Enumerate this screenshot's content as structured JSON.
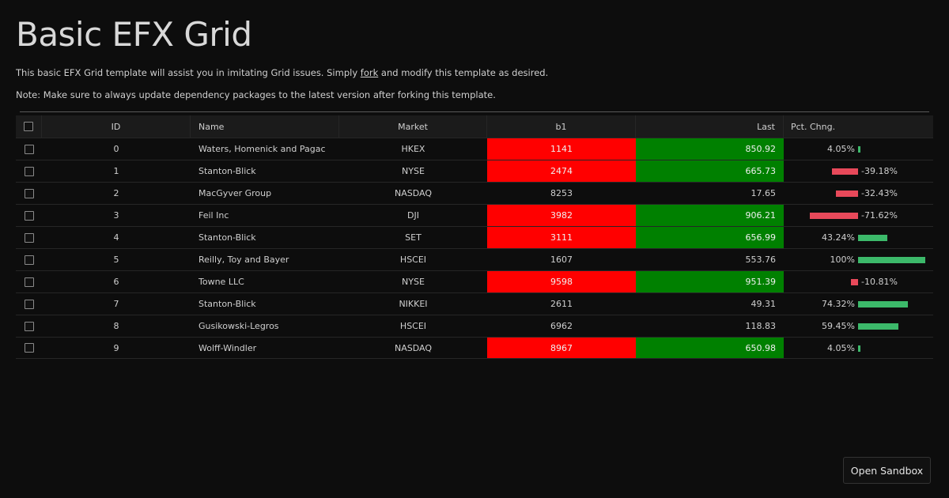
{
  "page": {
    "title": "Basic EFX Grid",
    "desc1_before": "This basic EFX Grid template will assist you in imitating Grid issues. Simply ",
    "desc1_link": "fork",
    "desc1_after": " and modify this template as desired.",
    "desc2": "Note: Make sure to always update dependency packages to the latest version after forking this template."
  },
  "grid": {
    "headers": {
      "id": "ID",
      "name": "Name",
      "market": "Market",
      "b1": "b1",
      "last": "Last",
      "pct": "Pct. Chng."
    },
    "rows": [
      {
        "id": "0",
        "name": "Waters, Homenick and Pagac",
        "market": "HKEX",
        "b1": "1141",
        "last": "850.92",
        "pct_label": "4.05%",
        "pct": 4.05,
        "highlight": true
      },
      {
        "id": "1",
        "name": "Stanton-Blick",
        "market": "NYSE",
        "b1": "2474",
        "last": "665.73",
        "pct_label": "-39.18%",
        "pct": -39.18,
        "highlight": true
      },
      {
        "id": "2",
        "name": "MacGyver Group",
        "market": "NASDAQ",
        "b1": "8253",
        "last": "17.65",
        "pct_label": "-32.43%",
        "pct": -32.43,
        "highlight": false
      },
      {
        "id": "3",
        "name": "Feil Inc",
        "market": "DJI",
        "b1": "3982",
        "last": "906.21",
        "pct_label": "-71.62%",
        "pct": -71.62,
        "highlight": true
      },
      {
        "id": "4",
        "name": "Stanton-Blick",
        "market": "SET",
        "b1": "3111",
        "last": "656.99",
        "pct_label": "43.24%",
        "pct": 43.24,
        "highlight": true
      },
      {
        "id": "5",
        "name": "Reilly, Toy and Bayer",
        "market": "HSCEI",
        "b1": "1607",
        "last": "553.76",
        "pct_label": "100%",
        "pct": 100,
        "highlight": false
      },
      {
        "id": "6",
        "name": "Towne LLC",
        "market": "NYSE",
        "b1": "9598",
        "last": "951.39",
        "pct_label": "-10.81%",
        "pct": -10.81,
        "highlight": true
      },
      {
        "id": "7",
        "name": "Stanton-Blick",
        "market": "NIKKEI",
        "b1": "2611",
        "last": "49.31",
        "pct_label": "74.32%",
        "pct": 74.32,
        "highlight": false
      },
      {
        "id": "8",
        "name": "Gusikowski-Legros",
        "market": "HSCEI",
        "b1": "6962",
        "last": "118.83",
        "pct_label": "59.45%",
        "pct": 59.45,
        "highlight": false
      },
      {
        "id": "9",
        "name": "Wolff-Windler",
        "market": "NASDAQ",
        "b1": "8967",
        "last": "650.98",
        "pct_label": "4.05%",
        "pct": 4.05,
        "highlight": true
      }
    ]
  },
  "colors": {
    "b1_highlight": "#ff0000",
    "last_highlight": "#008000",
    "pct_positive": "#3cb96a",
    "pct_negative": "#e8495a"
  },
  "sandbox_button": "Open Sandbox"
}
